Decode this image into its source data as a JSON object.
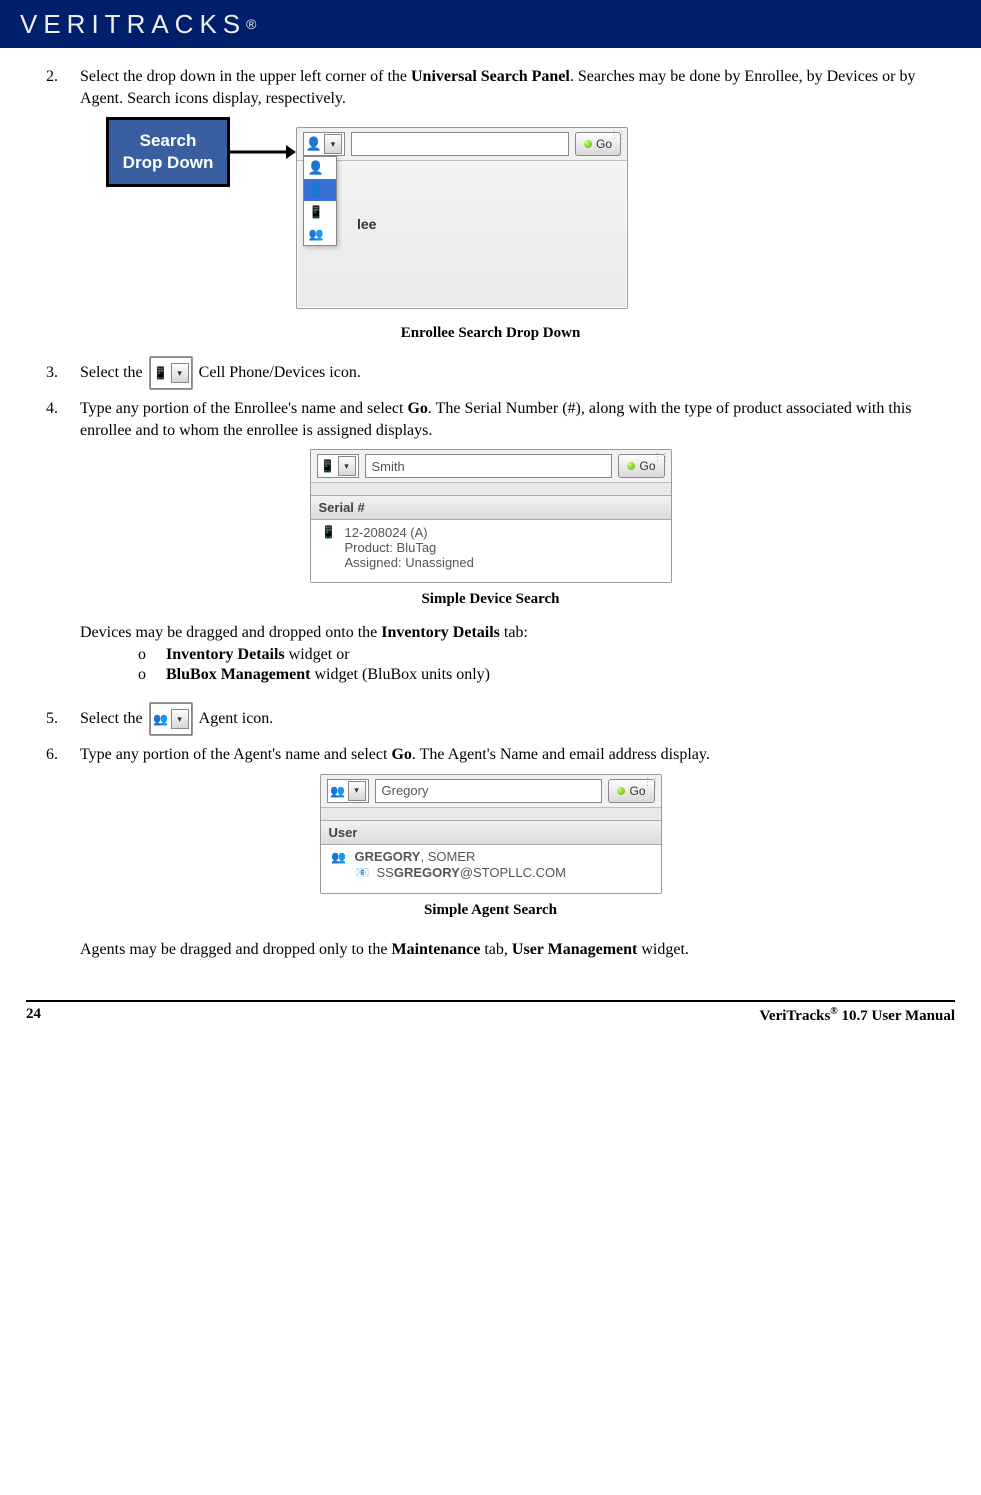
{
  "header": {
    "brand": "VERITRACKS",
    "brand_sup": "®"
  },
  "steps": {
    "s2": {
      "num": "2.",
      "text_a": "Select the drop down in the upper left corner of the ",
      "bold_a": "Universal Search Panel",
      "text_b": ". Searches may be done by Enrollee, by Devices or by Agent.  Search icons display, respectively."
    },
    "s3": {
      "num": "3.",
      "text_a": "Select the ",
      "text_b": " Cell Phone/Devices icon."
    },
    "s4": {
      "num": "4.",
      "text_a": "Type any portion of the Enrollee's name and select ",
      "bold_a": "Go",
      "text_b": ".  The Serial Number (#), along with the type of product associated with this enrollee and to whom the enrollee is assigned displays."
    },
    "s4b": {
      "text_a": "Devices may be dragged and dropped onto the ",
      "bold_a": "Inventory Details",
      "text_b": " tab:",
      "sub1_bold": "Inventory Details",
      "sub1_rest": " widget or",
      "sub2_bold": "BluBox Management",
      "sub2_rest": " widget (BluBox units only)"
    },
    "s5": {
      "num": "5.",
      "text_a": "Select the ",
      "text_b": " Agent icon."
    },
    "s6": {
      "num": "6.",
      "text_a": "Type any portion of the Agent's name and select ",
      "bold_a": "Go",
      "text_b": ".  The Agent's Name and email address display."
    },
    "s6b": {
      "text_a": "Agents may be dragged and dropped only to the ",
      "bold_a": "Maintenance",
      "text_b": " tab, ",
      "bold_b": "User Management",
      "text_c": " widget."
    }
  },
  "callout": {
    "line1": "Search",
    "line2": "Drop Down"
  },
  "captions": {
    "c1": "Enrollee Search Drop Down",
    "c2": "Simple Device Search",
    "c3": "Simple Agent Search"
  },
  "fig1": {
    "go": "Go",
    "lee": "lee"
  },
  "fig2": {
    "go": "Go",
    "input": "Smith",
    "header": "Serial #",
    "serial": "12-208024 (A)",
    "product": "Product: BluTag",
    "assigned": "Assigned: Unassigned"
  },
  "fig3": {
    "go": "Go",
    "input": "Gregory",
    "header": "User",
    "name_bold": "GREGORY",
    "name_rest": ", SOMER",
    "email_a": "SS",
    "email_b": "GREGORY",
    "email_c": "@STOPLLC.COM"
  },
  "footer": {
    "page": "24",
    "title_a": "VeriTracks",
    "title_sup": "®",
    "title_b": " 10.7 User Manual"
  },
  "bullet": "o"
}
